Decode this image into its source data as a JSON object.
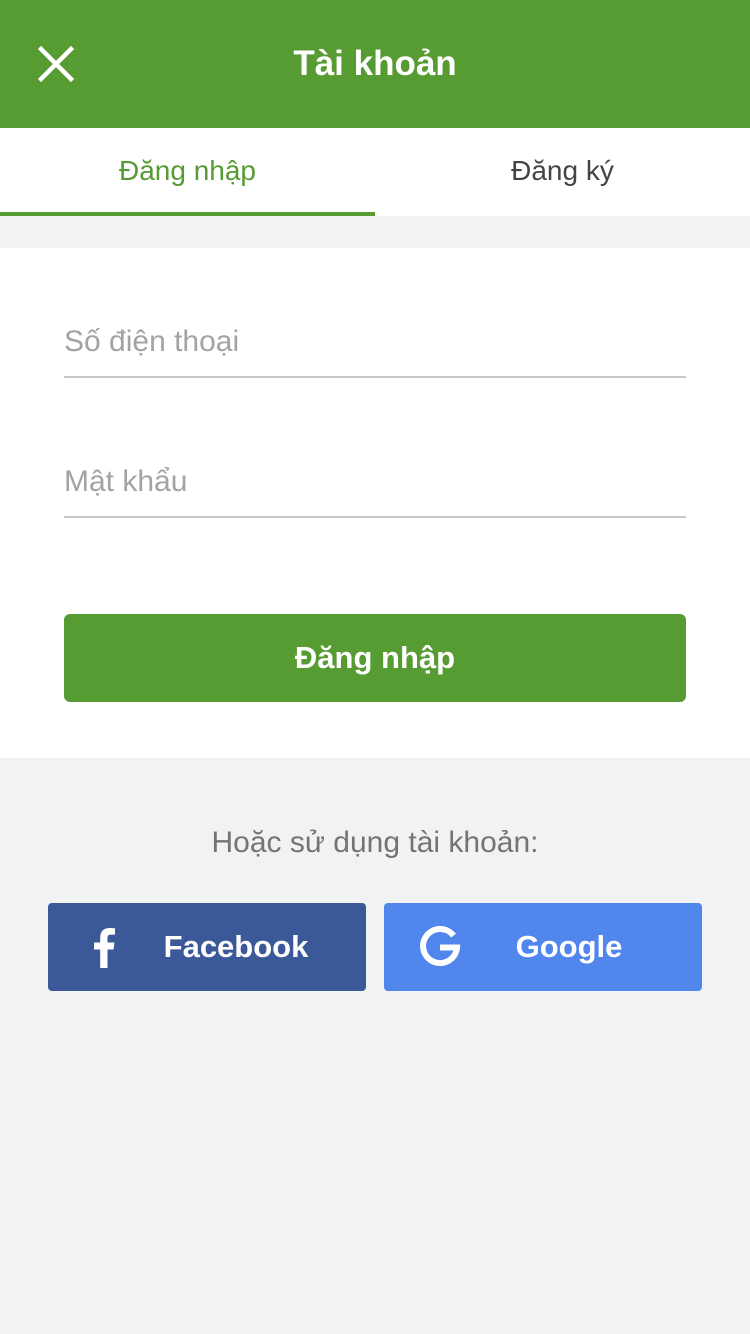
{
  "header": {
    "title": "Tài khoản",
    "close_icon": "close-icon"
  },
  "tabs": [
    {
      "label": "Đăng nhập",
      "active": true
    },
    {
      "label": "Đăng ký",
      "active": false
    }
  ],
  "form": {
    "phone": {
      "placeholder": "Số điện thoại",
      "value": ""
    },
    "password": {
      "placeholder": "Mật khẩu",
      "value": ""
    },
    "submit_label": "Đăng nhập"
  },
  "social": {
    "prompt": "Hoặc sử dụng tài khoản:",
    "facebook": {
      "label": "Facebook",
      "icon": "facebook-icon",
      "color": "#3b5998"
    },
    "google": {
      "label": "Google",
      "icon": "google-icon",
      "color": "#5186ec"
    }
  },
  "colors": {
    "primary": "#579b33",
    "background": "#f1f2f4"
  }
}
